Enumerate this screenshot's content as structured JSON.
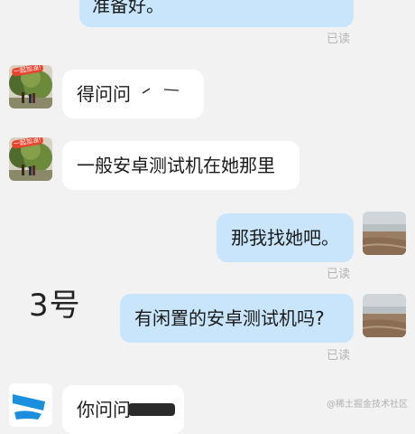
{
  "messages": [
    {
      "side": "out",
      "text": "准备好。",
      "status": "已读"
    },
    {
      "side": "in",
      "text": "得问问"
    },
    {
      "side": "in",
      "text": "一般安卓测试机在她那里"
    },
    {
      "side": "out",
      "text": "那我找她吧。",
      "status": "已读"
    },
    {
      "side": "out",
      "text": "有闲置的安卓测试机吗?",
      "status": "已读"
    },
    {
      "side": "in",
      "text": "你问问"
    }
  ],
  "overlay_label": "3号",
  "avatar_badge": "一起加油!",
  "watermark": "@稀土掘金技术社区",
  "colors": {
    "background": "#f2f2f2",
    "incoming_bubble": "#ffffff",
    "outgoing_bubble": "#c8e5fb",
    "read_status": "#b5b5b5"
  }
}
